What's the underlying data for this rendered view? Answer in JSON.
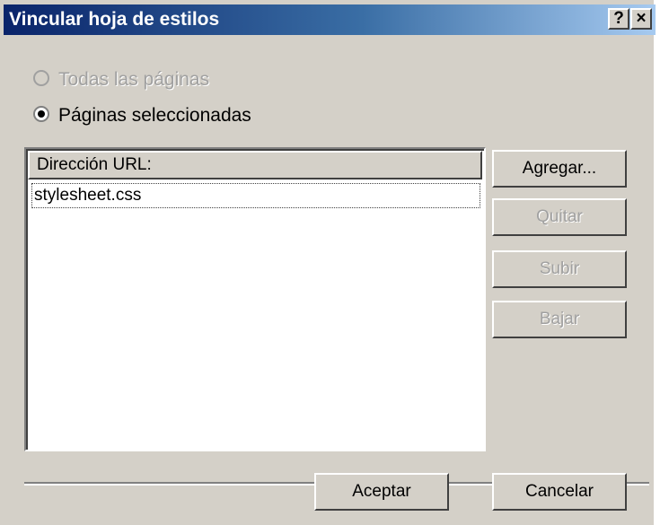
{
  "dialog": {
    "title": "Vincular hoja de estilos",
    "help_button": "?",
    "close_button": "×"
  },
  "options": {
    "all_pages_label": "Todas las páginas",
    "selected_pages_label": "Páginas seleccionadas",
    "selected": "selected_pages"
  },
  "list": {
    "column_header": "Dirección URL:",
    "items": [
      "stylesheet.css"
    ]
  },
  "side_buttons": {
    "add_label": "Agregar...",
    "remove_label": "Quitar",
    "up_label": "Subir",
    "down_label": "Bajar"
  },
  "footer": {
    "ok_label": "Aceptar",
    "cancel_label": "Cancelar"
  },
  "colors": {
    "title_gradient_start": "#0a246a",
    "title_gradient_end": "#a6caf0",
    "face": "#d4d0c8",
    "disabled_text": "#a0a0a0"
  }
}
